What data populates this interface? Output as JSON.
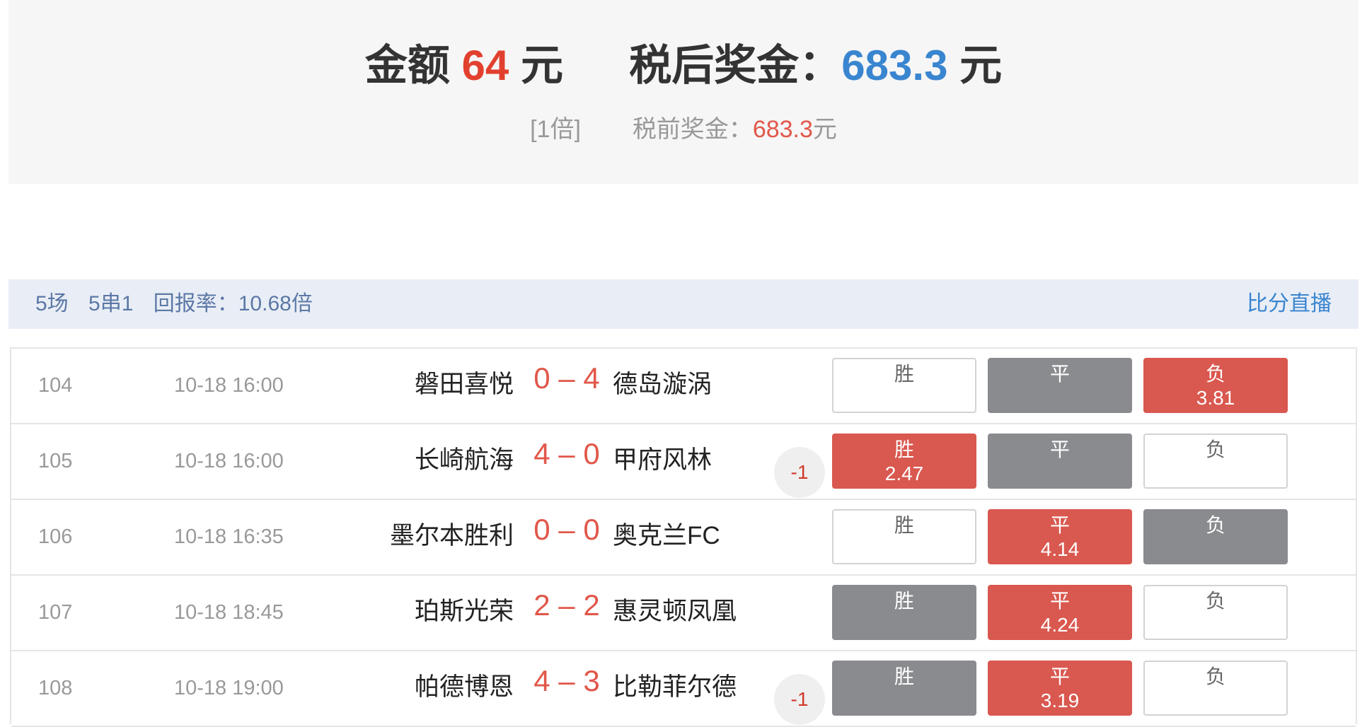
{
  "summary": {
    "amount_label": "金额",
    "amount_value": "64",
    "amount_unit": "元",
    "after_tax_label": "税后奖金：",
    "after_tax_value": "683.3",
    "after_tax_unit": "元",
    "multiplier": "[1倍]",
    "pre_tax_label": "税前奖金：",
    "pre_tax_value": "683.3",
    "pre_tax_unit": "元"
  },
  "bar": {
    "matches": "5场",
    "combo": "5串1",
    "return_rate": "回报率：10.68倍",
    "live_link": "比分直播"
  },
  "rows": [
    {
      "id": "104",
      "time": "10-18 16:00",
      "home": "磐田喜悦",
      "score": "0 – 4",
      "away": "德岛漩涡",
      "handicap": "",
      "options": [
        {
          "label": "胜",
          "odd": "",
          "state": "white"
        },
        {
          "label": "平",
          "odd": "",
          "state": "gray"
        },
        {
          "label": "负",
          "odd": "3.81",
          "state": "red"
        }
      ]
    },
    {
      "id": "105",
      "time": "10-18 16:00",
      "home": "长崎航海",
      "score": "4 – 0",
      "away": "甲府风林",
      "handicap": "-1",
      "options": [
        {
          "label": "胜",
          "odd": "2.47",
          "state": "red"
        },
        {
          "label": "平",
          "odd": "",
          "state": "gray"
        },
        {
          "label": "负",
          "odd": "",
          "state": "white"
        }
      ]
    },
    {
      "id": "106",
      "time": "10-18 16:35",
      "home": "墨尔本胜利",
      "score": "0 – 0",
      "away": "奥克兰FC",
      "handicap": "",
      "options": [
        {
          "label": "胜",
          "odd": "",
          "state": "white"
        },
        {
          "label": "平",
          "odd": "4.14",
          "state": "red"
        },
        {
          "label": "负",
          "odd": "",
          "state": "gray"
        }
      ]
    },
    {
      "id": "107",
      "time": "10-18 18:45",
      "home": "珀斯光荣",
      "score": "2 – 2",
      "away": "惠灵顿凤凰",
      "handicap": "",
      "options": [
        {
          "label": "胜",
          "odd": "",
          "state": "gray"
        },
        {
          "label": "平",
          "odd": "4.24",
          "state": "red"
        },
        {
          "label": "负",
          "odd": "",
          "state": "white"
        }
      ]
    },
    {
      "id": "108",
      "time": "10-18 19:00",
      "home": "帕德博恩",
      "score": "4 – 3",
      "away": "比勒菲尔德",
      "handicap": "-1",
      "options": [
        {
          "label": "胜",
          "odd": "",
          "state": "gray"
        },
        {
          "label": "平",
          "odd": "3.19",
          "state": "red"
        },
        {
          "label": "负",
          "odd": "",
          "state": "white"
        }
      ]
    }
  ]
}
